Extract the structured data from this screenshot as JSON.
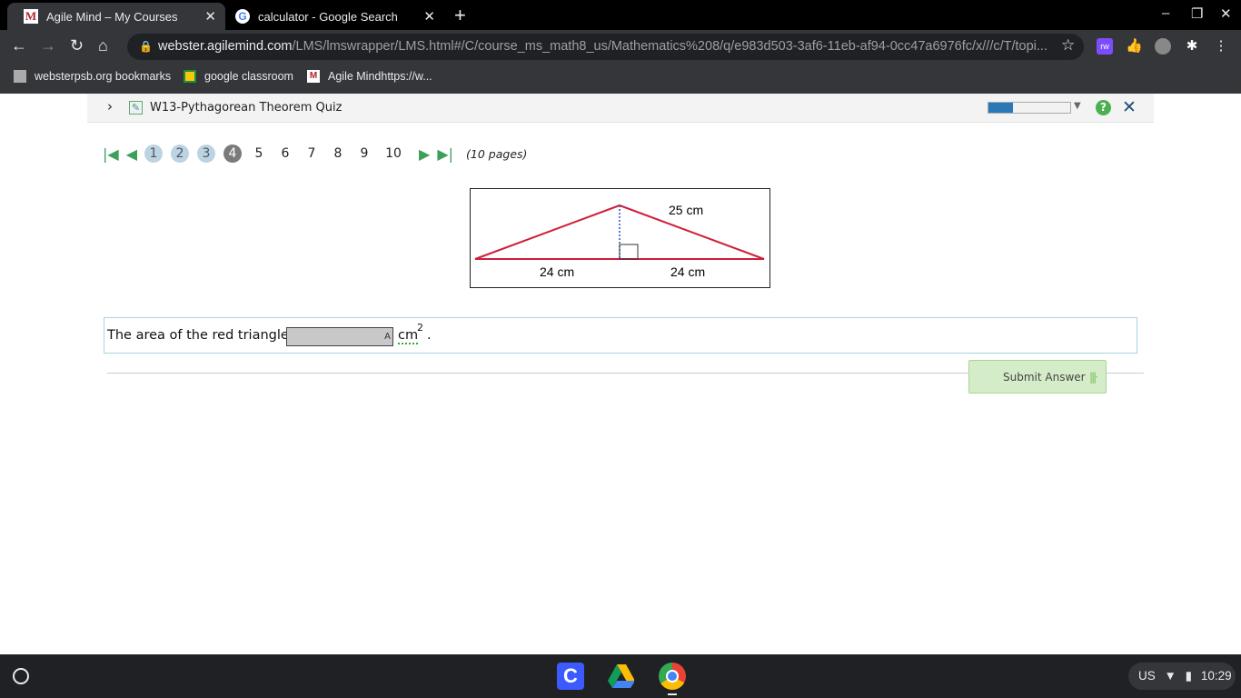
{
  "browser": {
    "tabs": [
      {
        "title": "Agile Mind – My Courses",
        "active": true
      },
      {
        "title": "calculator - Google Search",
        "active": false
      }
    ],
    "url_host": "webster.agilemind.com",
    "url_path": "/LMS/lmswrapper/LMS.html#/C/course_ms_math8_us/Mathematics%208/q/e983d503-3af6-11eb-af94-0cc47a6976fc/x///c/T/topi...",
    "bookmarks": [
      {
        "label": "websterpsb.org bookmarks",
        "icon": "folder-icon"
      },
      {
        "label": "google classroom",
        "icon": "classroom-icon"
      },
      {
        "label": "Agile Mindhttps://w...",
        "icon": "agilemind-icon"
      }
    ]
  },
  "quiz": {
    "title": "W13-Pythagorean Theorem Quiz",
    "progress_percent": 30,
    "help_label": "?",
    "pager": {
      "pages": [
        "1",
        "2",
        "3",
        "4",
        "5",
        "6",
        "7",
        "8",
        "9",
        "10"
      ],
      "completed": [
        1,
        2,
        3
      ],
      "current": 4,
      "summary": "(10 pages)"
    },
    "figure": {
      "hypotenuse_label": "25 cm",
      "left_base_label": "24 cm",
      "right_base_label": "24 cm",
      "colors": {
        "triangle": "#d01f3c",
        "height": "#2255cc"
      }
    },
    "question": {
      "text": "The area of the red triangle is",
      "answer_value": "",
      "input_badge": "A",
      "unit": "cm",
      "exponent": "2",
      "end": "."
    },
    "submit_label": "Submit Answer"
  },
  "system": {
    "locale": "US",
    "time": "10:29"
  }
}
